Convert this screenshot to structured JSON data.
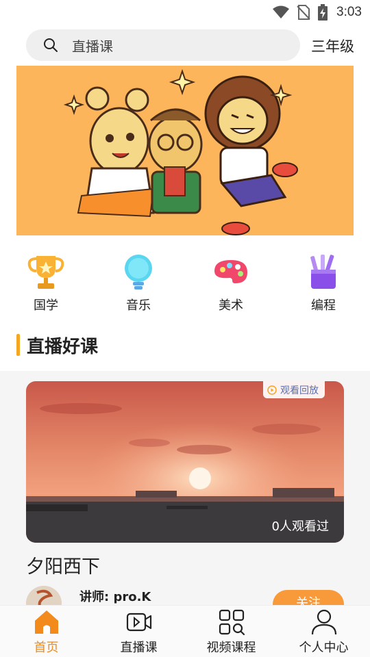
{
  "status_bar": {
    "time": "3:03"
  },
  "search": {
    "placeholder": "直播课"
  },
  "grade": "三年级",
  "categories": [
    {
      "label": "国学",
      "icon": "trophy-icon"
    },
    {
      "label": "音乐",
      "icon": "lightbulb-icon"
    },
    {
      "label": "美术",
      "icon": "palette-icon"
    },
    {
      "label": "编程",
      "icon": "pencil-cup-icon"
    }
  ],
  "section": {
    "title": "直播好课"
  },
  "course": {
    "replay_label": "观看回放",
    "viewers": "0人观看过",
    "title": "夕阳西下",
    "teacher": "讲师: pro.K",
    "follow_label": "关注"
  },
  "tabs": [
    {
      "label": "首页",
      "icon": "home-icon",
      "active": true
    },
    {
      "label": "直播课",
      "icon": "video-camera-icon",
      "active": false
    },
    {
      "label": "视频课程",
      "icon": "grid-search-icon",
      "active": false
    },
    {
      "label": "个人中心",
      "icon": "person-icon",
      "active": false
    }
  ],
  "colors": {
    "accent": "#f28a1c",
    "banner_bg": "#fdb55c",
    "section_bar": "#f5a623",
    "follow_button": "#f99a3a"
  }
}
